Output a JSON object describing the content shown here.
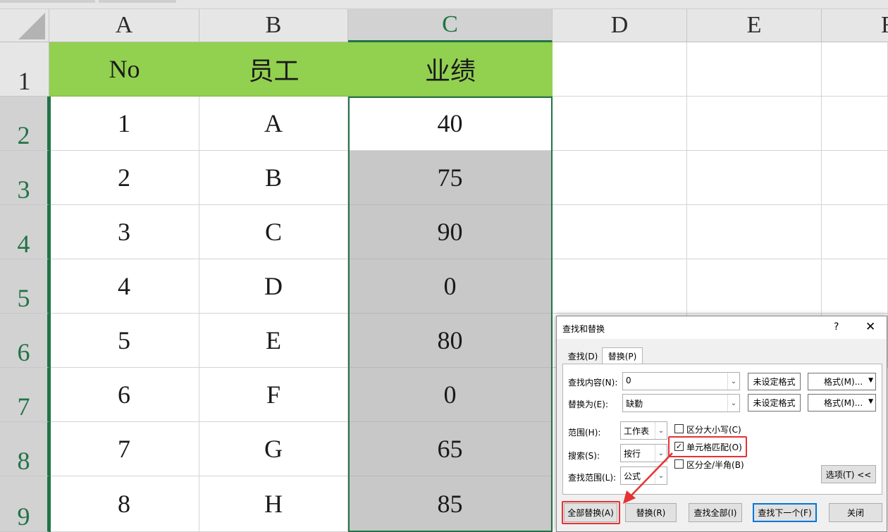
{
  "columns": [
    "A",
    "B",
    "C",
    "D",
    "E",
    "F"
  ],
  "rows": [
    "1",
    "2",
    "3",
    "4",
    "5",
    "6",
    "7",
    "8",
    "9"
  ],
  "table": {
    "headers": [
      "No",
      "员工",
      "业绩"
    ],
    "data": [
      [
        "1",
        "A",
        "40"
      ],
      [
        "2",
        "B",
        "75"
      ],
      [
        "3",
        "C",
        "90"
      ],
      [
        "4",
        "D",
        "0"
      ],
      [
        "5",
        "E",
        "80"
      ],
      [
        "6",
        "F",
        "0"
      ],
      [
        "7",
        "G",
        "65"
      ],
      [
        "8",
        "H",
        "85"
      ]
    ]
  },
  "colors": {
    "header_fill": "#92d050",
    "selection_fill": "#c8c8c8",
    "selection_border": "#217346",
    "highlight": "#e53232"
  },
  "dialog": {
    "title": "查找和替换",
    "help": "?",
    "close_glyph": "✕",
    "tabs": [
      "查找(D)",
      "替换(P)"
    ],
    "find_label": "查找内容(N):",
    "find_value": "0",
    "replace_label": "替换为(E):",
    "replace_value": "缺勤",
    "no_format": "未设定格式",
    "format_button": "格式(M)...",
    "within_label": "范围(H):",
    "within_value": "工作表",
    "search_label": "搜索(S):",
    "search_value": "按行",
    "lookin_label": "查找范围(L):",
    "lookin_value": "公式",
    "match_case": "区分大小写(C)",
    "match_entire": "单元格匹配(O)",
    "match_byte": "区分全/半角(B)",
    "match_entire_checked": true,
    "options_button": "选项(T) <<",
    "buttons": {
      "replace_all": "全部替换(A)",
      "replace": "替换(R)",
      "find_all": "查找全部(I)",
      "find_next": "查找下一个(F)",
      "close": "关闭"
    }
  }
}
